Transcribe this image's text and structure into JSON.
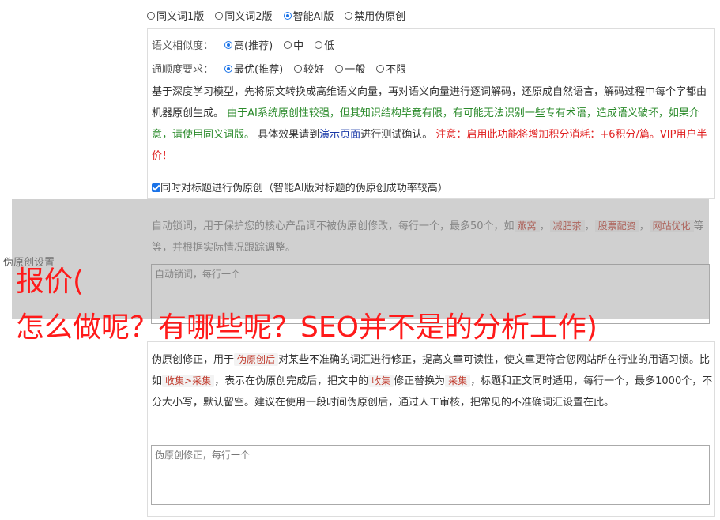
{
  "mode_options": [
    {
      "label": "同义词1版",
      "selected": false
    },
    {
      "label": "同义词2版",
      "selected": false
    },
    {
      "label": "智能AI版",
      "selected": true
    },
    {
      "label": "禁用伪原创",
      "selected": false
    }
  ],
  "similarity": {
    "label": "语义相似度：",
    "options": [
      {
        "label": "高(推荐)",
        "selected": true
      },
      {
        "label": "中",
        "selected": false
      },
      {
        "label": "低",
        "selected": false
      }
    ]
  },
  "fluency": {
    "label": "通顺度要求：",
    "options": [
      {
        "label": "最优(推荐)",
        "selected": true
      },
      {
        "label": "较好",
        "selected": false
      },
      {
        "label": "一般",
        "selected": false
      },
      {
        "label": "不限",
        "selected": false
      }
    ]
  },
  "description": {
    "part1": "基于深度学习模型，先将原文转换成高维语义向量，再对语义向量进行逐词解码，还原成自然语言，解码过程中每个字都由机器原创生成。",
    "part2": "由于AI系统原创性较强，但其知识结构毕竟有限，有可能无法识别一些专有术语，造成语义破坏，如果介意，请使用同义词版。",
    "part3": "具体效果请到",
    "link": "演示页面",
    "part4": "进行测试确认。",
    "warning": "注意：启用此功能将增加积分消耗：+6积分/篇。VIP用户半价！"
  },
  "title_checkbox": {
    "label": "同时对标题进行伪原创（智能AI版对标题的伪原创成功率较高）",
    "checked": true
  },
  "side_label": "伪原创设置",
  "lock_words": {
    "text1": "自动锁词，用于保护您的核心产品词不被伪原创修改，每行一个，最多50个，如",
    "examples": [
      "燕窝",
      "减肥茶",
      "股票配资",
      "网站优化"
    ],
    "text2": "等等，并根据实际情况跟踪调整。",
    "placeholder": "自动锁词，每行一个"
  },
  "overlay_text": {
    "line1": "报价(",
    "line2": "怎么做呢？有哪些呢？SEO并不是的分析工作)"
  },
  "correction": {
    "text1": "伪原创修正，用于",
    "tag1": "伪原创后",
    "text2": "对某些不准确的词汇进行修正，提高文章可读性，使文章更符合您网站所在行业的用语习惯。比如",
    "tag2": "收集>采集",
    "text3": "，表示在伪原创完成后，把文中的",
    "tag3": "收集",
    "text4": "修正替换为",
    "tag4": "采集",
    "text5": "，标题和正文同时适用，每行一个，最多1000个，不分大小写，默认留空。建议在使用一段时间伪原创后，通过人工审核，把常见的不准确词汇设置在此。",
    "placeholder": "伪原创修正，每行一个"
  }
}
